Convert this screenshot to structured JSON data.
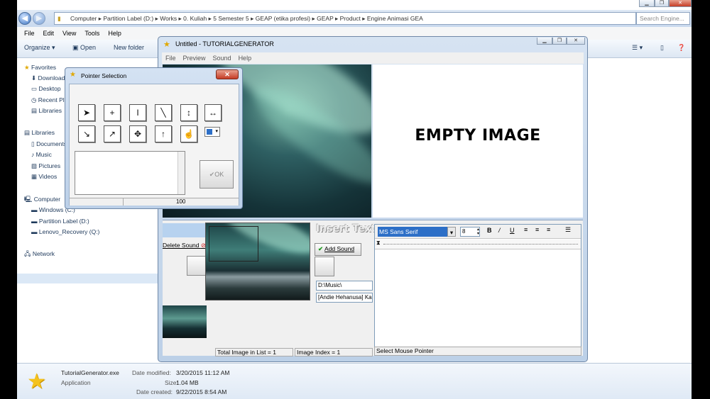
{
  "explorer": {
    "address_parts": [
      "Computer",
      "Partition Label (D:)",
      "Works",
      "0. Kuliah",
      "5 Semester 5",
      "GEAP (etika profesi)",
      "GEAP",
      "Product",
      "Engine Animasi GEA"
    ],
    "search_placeholder": "Search Engine...",
    "menu": [
      "File",
      "Edit",
      "View",
      "Tools",
      "Help"
    ],
    "commands": {
      "organize": "Organize",
      "open": "Open",
      "new_folder": "New folder"
    },
    "nav": {
      "favorites": "Favorites",
      "downloads": "Downloads",
      "desktop": "Desktop",
      "recent": "Recent Places",
      "libraries_fav": "Libraries",
      "libraries": "Libraries",
      "documents": "Documents",
      "music": "Music",
      "pictures": "Pictures",
      "videos": "Videos",
      "computer": "Computer",
      "windows": "Windows (C:)",
      "partition": "Partition Label (D:)",
      "lenovo": "Lenovo_Recovery (Q:)",
      "network": "Network"
    },
    "details": {
      "filename": "TutorialGenerator.exe",
      "type": "Application",
      "modified_label": "Date modified:",
      "modified": "3/20/2015 11:12 AM",
      "size_label": "Size:",
      "size": "1.04 MB",
      "created_label": "Date created:",
      "created": "9/22/2015 8:54 AM"
    }
  },
  "tg": {
    "title": "Untitled - TUTORIALGENERATOR",
    "menu": [
      "File",
      "Preview",
      "Sound",
      "Help"
    ],
    "empty_image": "EMPTY IMAGE",
    "delete_sound": "Delete Sound",
    "add_sound": "Add Sound",
    "insert_text": "Insert Text",
    "path": "D:\\Music\\",
    "song": "[Andie Hehanusa] Ka",
    "font": "MS Sans Serif",
    "font_size": "8",
    "status": "Select Mouse Pointer",
    "total_images": "Total Image in List = 1",
    "image_index": "Image Index = 1"
  },
  "ps": {
    "title": "Pointer Selection",
    "ok": "OK",
    "value": "100"
  }
}
